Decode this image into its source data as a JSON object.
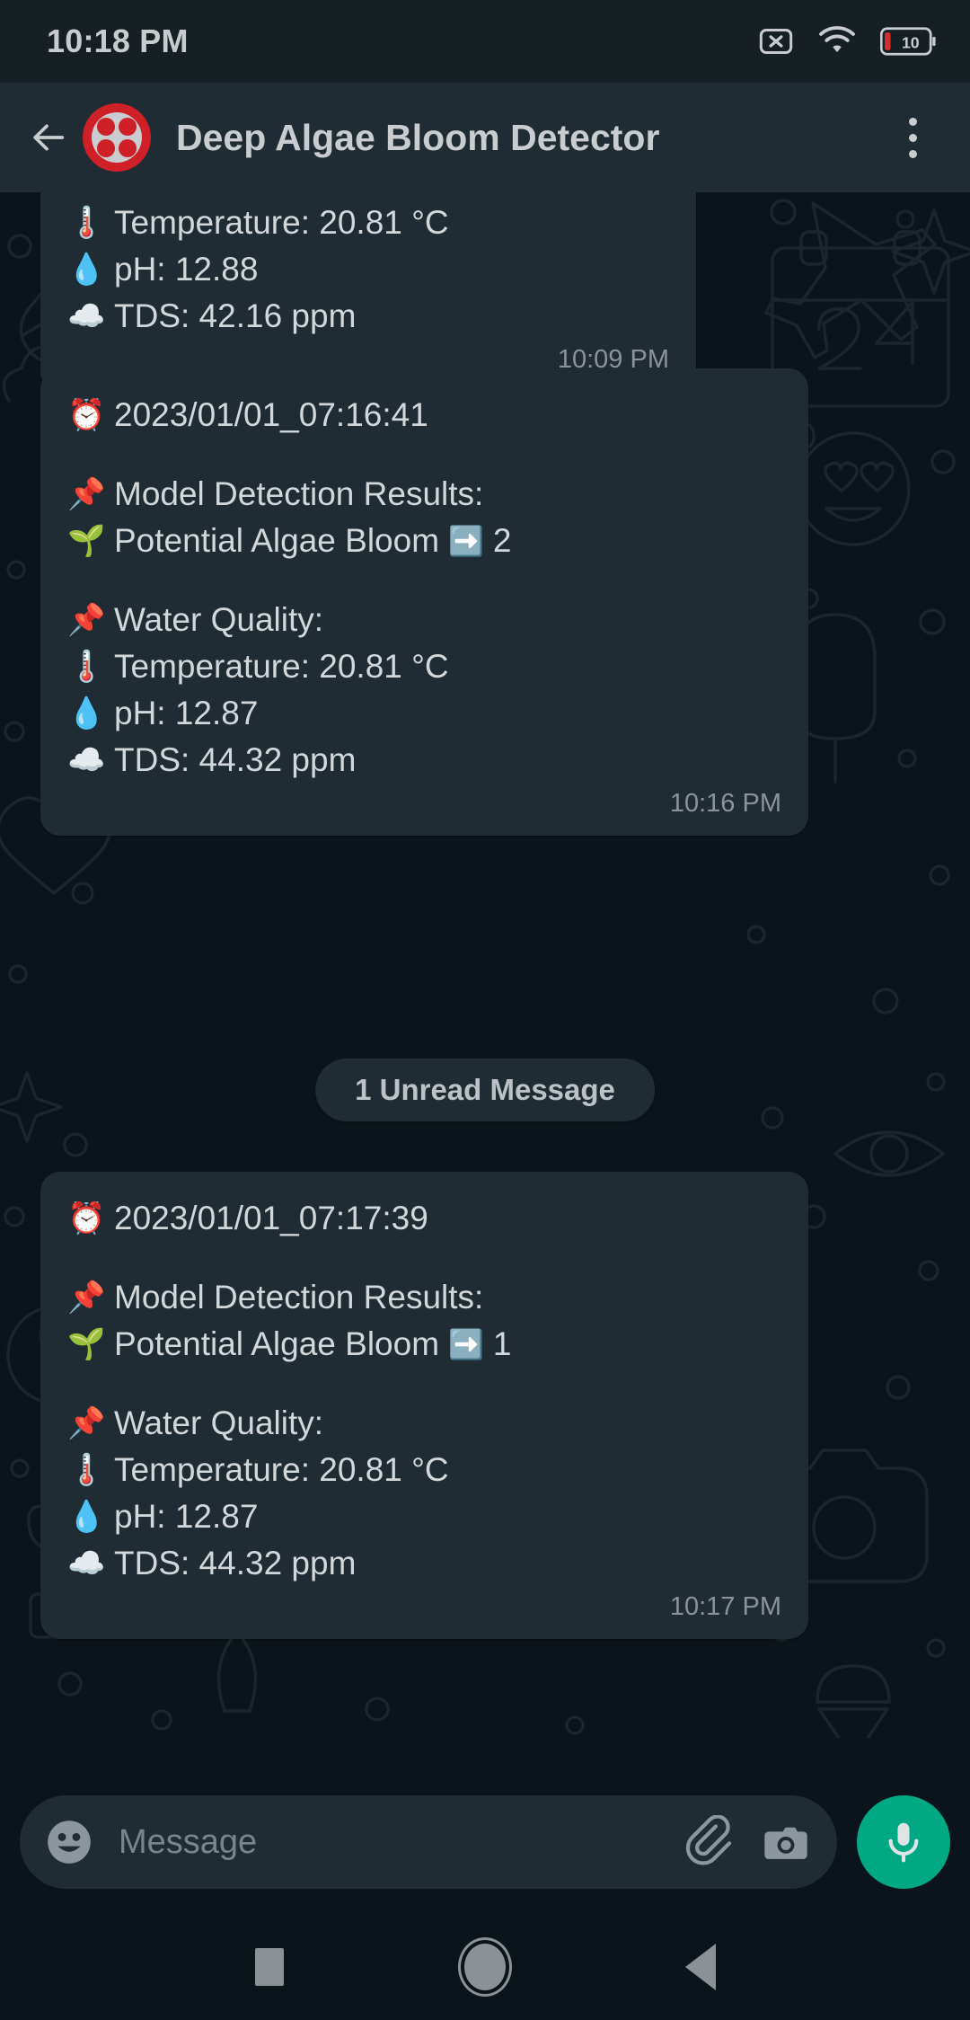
{
  "status_bar": {
    "clock": "10:18 PM",
    "icons": [
      "no-sim-icon",
      "wifi-icon",
      "battery-icon"
    ],
    "battery_level": "10",
    "battery_color": "#d32f2f"
  },
  "app_bar": {
    "back_icon": "back-arrow-icon",
    "avatar_name": "contact-avatar",
    "avatar_color": "#cf2027",
    "title": "Deep Algae Bloom Detector",
    "menu_icon": "overflow-menu-icon"
  },
  "chat": {
    "background_color": "#0b141a",
    "bubble_color": "#1f2c34",
    "unread_divider": "1 Unread Message",
    "messages": [
      {
        "id": "msg-1",
        "clipped": true,
        "lines": [
          {
            "emoji": "🌡️",
            "text": "Temperature: 20.81 °C"
          },
          {
            "emoji": "💧",
            "text": "pH: 12.88"
          },
          {
            "emoji": "☁️",
            "text": "TDS: 42.16  ppm"
          }
        ],
        "time": "10:09 PM"
      },
      {
        "id": "msg-2",
        "clipped": false,
        "timestamp_line": {
          "emoji": "⏰",
          "text": "2023/01/01_07:16:41"
        },
        "detection_header": {
          "emoji": "📌",
          "text": "Model Detection Results:"
        },
        "detection_result": {
          "emoji": "🌱",
          "label": "Potential Algae Bloom",
          "arrow": "➡️",
          "count": "2"
        },
        "quality_header": {
          "emoji": "📌",
          "text": "Water Quality:"
        },
        "lines": [
          {
            "emoji": "🌡️",
            "text": "Temperature: 20.81 °C"
          },
          {
            "emoji": "💧",
            "text": "pH: 12.87"
          },
          {
            "emoji": "☁️",
            "text": "TDS: 44.32  ppm"
          }
        ],
        "time": "10:16 PM"
      },
      {
        "id": "msg-3",
        "clipped": false,
        "timestamp_line": {
          "emoji": "⏰",
          "text": "2023/01/01_07:17:39"
        },
        "detection_header": {
          "emoji": "📌",
          "text": "Model Detection Results:"
        },
        "detection_result": {
          "emoji": "🌱",
          "label": "Potential Algae Bloom",
          "arrow": "➡️",
          "count": "1"
        },
        "quality_header": {
          "emoji": "📌",
          "text": "Water Quality:"
        },
        "lines": [
          {
            "emoji": "🌡️",
            "text": "Temperature: 20.81 °C"
          },
          {
            "emoji": "💧",
            "text": "pH: 12.87"
          },
          {
            "emoji": "☁️",
            "text": "TDS: 44.32  ppm"
          }
        ],
        "time": "10:17 PM"
      }
    ]
  },
  "input_bar": {
    "emoji_icon": "emoji-smiley-icon",
    "placeholder": "Message",
    "value": "",
    "attach_icon": "paperclip-icon",
    "camera_icon": "camera-icon",
    "mic_icon": "microphone-icon",
    "mic_color": "#00a884"
  },
  "nav_bar": {
    "recents": "recents-square-icon",
    "home": "home-circle-icon",
    "back": "back-triangle-icon"
  }
}
